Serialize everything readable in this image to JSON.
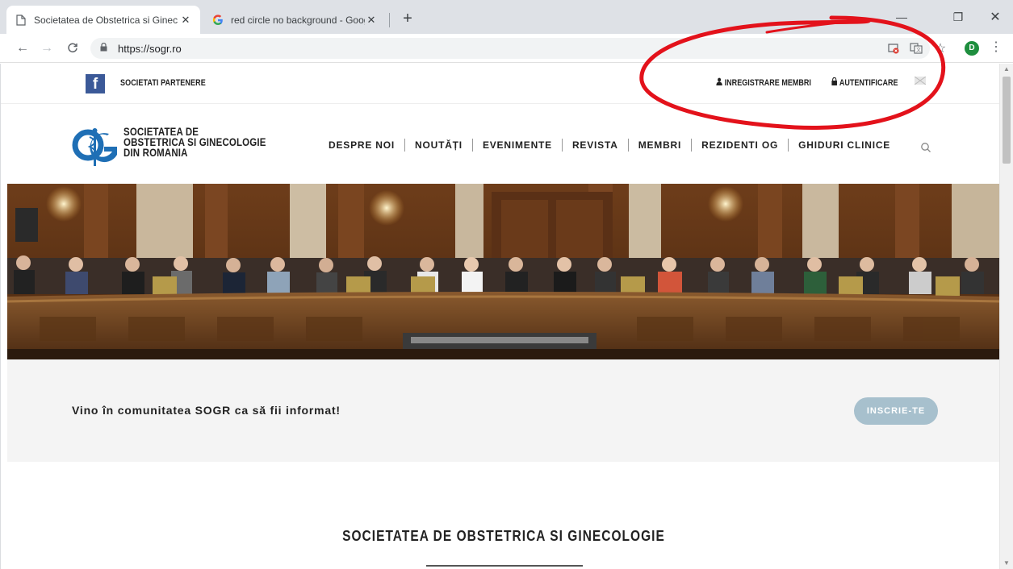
{
  "browser": {
    "tabs": [
      {
        "title": "Societatea de Obstetrica si Ginec",
        "favicon": "page-icon",
        "active": true
      },
      {
        "title": "red circle no background - Goog",
        "favicon": "google-g-icon",
        "active": false
      }
    ],
    "new_tab": "+",
    "window_controls": {
      "minimize": "—",
      "maximize": "❐",
      "close": "✕"
    },
    "nav": {
      "back": "←",
      "forward": "→",
      "reload": "C"
    },
    "url": "https://sogr.ro",
    "profile_initial": "D",
    "colors": {
      "tabstrip": "#dee1e6",
      "omnibox": "#f1f3f4",
      "profile": "#1e8e3e"
    }
  },
  "site": {
    "topbar": {
      "partners_label": "SOCIETATI PARTENERE",
      "register_label": "INREGISTRARE MEMBRI",
      "login_label": "AUTENTIFICARE",
      "facebook_glyph": "f"
    },
    "logo": {
      "line1": "SOCIETATEA DE",
      "line2": "OBSTETRICA SI GINECOLOGIE",
      "line3": "DIN ROMANIA"
    },
    "nav": [
      "DESPRE NOI",
      "NOUTĂȚI",
      "EVENIMENTE",
      "REVISTA",
      "MEMBRI",
      "REZIDENTI OG",
      "GHIDURI CLINICE"
    ],
    "community": {
      "text": "Vino în comunitatea SOGR ca să fii informat!",
      "button_label": "INSCRIE-TE"
    },
    "section_title": "SOCIETATEA DE OBSTETRICA SI GINECOLOGIE",
    "colors": {
      "facebook": "#3b5998",
      "logo_blue": "#1f6fb5",
      "button": "#a7c0cd",
      "band": "#f4f4f4",
      "annotation": "#e3121b"
    }
  }
}
